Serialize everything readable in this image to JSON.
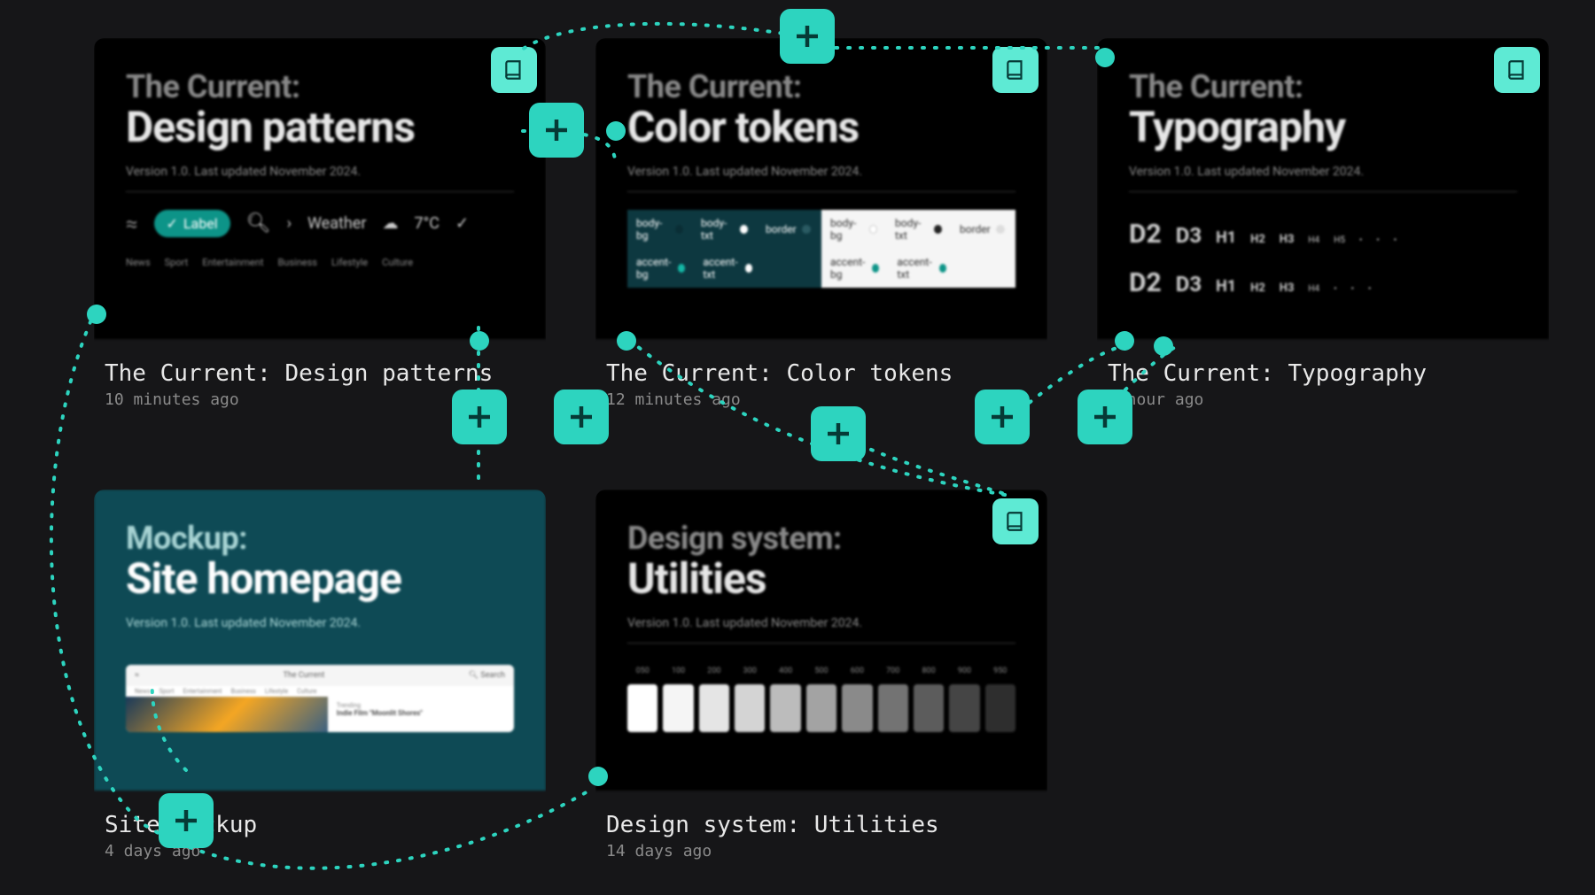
{
  "cards": [
    {
      "id": "design-patterns",
      "title": "The Current: Design patterns",
      "time": "10 minutes ago",
      "thumb_line1": "The Current:",
      "thumb_line2": "Design patterns",
      "version": "Version 1.0. Last updated November 2024.",
      "label_chip": "Label",
      "weather_label": "Weather",
      "weather_temp": "7°C",
      "categories": [
        "News",
        "Sport",
        "Entertainment",
        "Business",
        "Lifestyle",
        "Culture"
      ]
    },
    {
      "id": "color-tokens",
      "title": "The Current: Color tokens",
      "time": "12 minutes ago",
      "thumb_line1": "The Current:",
      "thumb_line2": "Color tokens",
      "version": "Version 1.0. Last updated November 2024.",
      "tokens_dark": [
        "body-bg",
        "body-txt",
        "border",
        "accent-bg",
        "accent-txt"
      ],
      "tokens_light": [
        "body-bg",
        "body-txt",
        "border",
        "accent-bg",
        "accent-txt"
      ]
    },
    {
      "id": "typography",
      "title": "The Current: Typography",
      "time": "1 hour ago",
      "thumb_line1": "The Current:",
      "thumb_line2": "Typography",
      "version": "Version 1.0. Last updated November 2024.",
      "scale": [
        "D2",
        "D3",
        "H1",
        "H2",
        "H3",
        "H4",
        "H5"
      ]
    },
    {
      "id": "site-mockup",
      "title": "Site Mockup",
      "time": "4 days ago",
      "thumb_line1": "Mockup:",
      "thumb_line2": "Site homepage",
      "version": "Version 1.0. Last updated November 2024.",
      "browser_title": "The Current",
      "browser_search": "Search",
      "headline_tag": "Trending",
      "headline_text": "Indie Film \"Moonlit Shores\"",
      "nav": [
        "News",
        "Sport",
        "Entertainment",
        "Business",
        "Lifestyle",
        "Culture"
      ]
    },
    {
      "id": "utilities",
      "title": "Design system: Utilities",
      "time": "14 days ago",
      "thumb_line1": "Design system:",
      "thumb_line2": "Utilities",
      "version": "Version 1.0. Last updated November 2024.",
      "gray_labels": [
        "050",
        "100",
        "200",
        "300",
        "400",
        "500",
        "600",
        "700",
        "800",
        "900",
        "950"
      ],
      "gray_colors": [
        "#ffffff",
        "#f5f5f5",
        "#e5e5e5",
        "#d4d4d4",
        "#bcbcbc",
        "#a3a3a3",
        "#8a8a8a",
        "#737373",
        "#5c5c5c",
        "#454545",
        "#2e2e2e"
      ]
    }
  ]
}
